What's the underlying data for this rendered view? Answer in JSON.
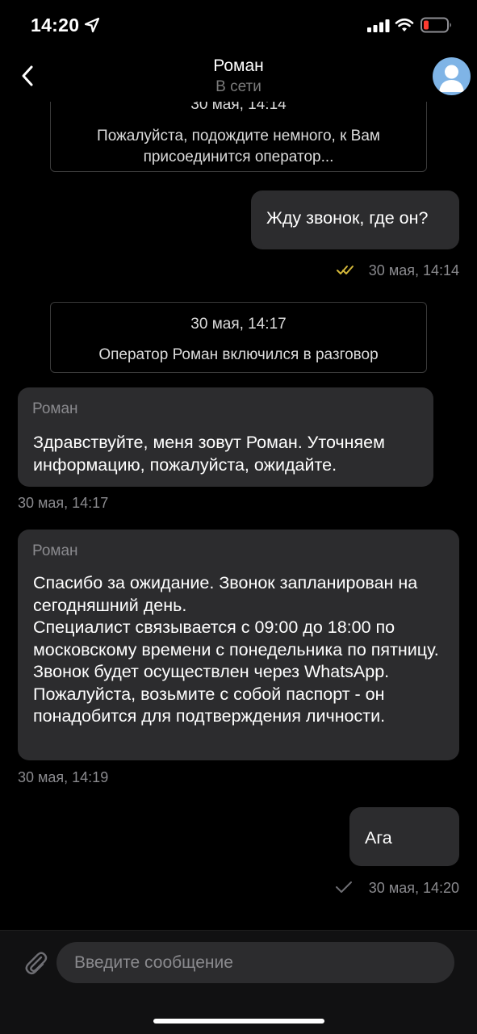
{
  "status_bar": {
    "time": "14:20",
    "icons": [
      "location-arrow-icon",
      "signal-bars-icon",
      "wifi-icon",
      "battery-low-icon"
    ],
    "battery_color": "#ff3b30"
  },
  "header": {
    "name": "Роман",
    "status": "В сети",
    "back_icon": "chevron-left-icon",
    "avatar_icon": "user-avatar-icon"
  },
  "messages": {
    "sys1": {
      "time": "30 мая, 14:14",
      "text": "Пожалуйста, подождите немного, к Вам присоединится оператор..."
    },
    "out1": {
      "text": "Жду звонок, где он?",
      "time": "30 мая, 14:14",
      "status_icon": "double-check-icon",
      "status_color": "#d4b83a"
    },
    "sys2": {
      "time": "30 мая, 14:17",
      "text": "Оператор Роман включился в разговор"
    },
    "in1": {
      "sender": "Роман",
      "text": "Здравствуйте, меня зовут Роман. Уточняем информацию, пожалуйста, ожидайте.",
      "time": "30 мая, 14:17"
    },
    "in2": {
      "sender": "Роман",
      "text": "Спасибо за ожидание. Звонок запланирован на сегодняшний день.\nСпециалист связывается с 09:00 до 18:00 по московскому времени с понедельника по пятницу. Звонок будет осуществлен через WhatsApp. Пожалуйста, возьмите с собой паспорт - он понадобится для подтверждения личности.",
      "time": "30 мая, 14:19"
    },
    "out2": {
      "text": "Ага",
      "time": "30 мая, 14:20",
      "status_icon": "single-check-icon",
      "status_color": "#6e6e73"
    }
  },
  "composer": {
    "placeholder": "Введите сообщение",
    "attach_icon": "paperclip-icon"
  },
  "colors": {
    "background": "#000000",
    "bubble": "#2c2c2e",
    "muted_text": "#8a8a8e"
  }
}
